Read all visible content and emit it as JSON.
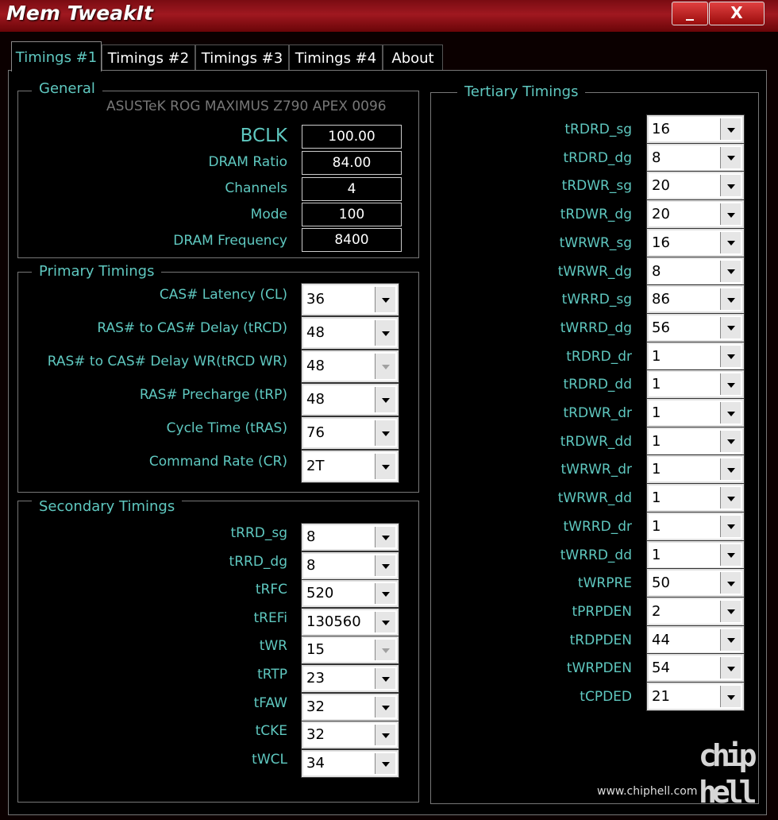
{
  "window": {
    "title": "Mem TweakIt",
    "minimize": "_",
    "close": "X"
  },
  "tabs": [
    "Timings #1",
    "Timings #2",
    "Timings #3",
    "Timings #4",
    "About"
  ],
  "general": {
    "legend": "General",
    "board": "ASUSTeK ROG MAXIMUS Z790 APEX 0096",
    "fields": [
      {
        "label": "BCLK",
        "value": "100.00"
      },
      {
        "label": "DRAM Ratio",
        "value": "84.00"
      },
      {
        "label": "Channels",
        "value": "4"
      },
      {
        "label": "Mode",
        "value": "100"
      },
      {
        "label": "DRAM Frequency",
        "value": "8400"
      }
    ]
  },
  "primary": {
    "legend": "Primary Timings",
    "rows": [
      {
        "label": "CAS# Latency (CL)",
        "value": "36"
      },
      {
        "label": "RAS# to CAS# Delay (tRCD)",
        "value": "48"
      },
      {
        "label": "RAS# to CAS# Delay WR(tRCD WR)",
        "value": "48",
        "disabled": true
      },
      {
        "label": "RAS# Precharge (tRP)",
        "value": "48"
      },
      {
        "label": "Cycle Time (tRAS)",
        "value": "76"
      },
      {
        "label": "Command Rate (CR)",
        "value": "2T"
      }
    ]
  },
  "secondary": {
    "legend": "Secondary Timings",
    "rows": [
      {
        "label": "tRRD_sg",
        "value": "8"
      },
      {
        "label": "tRRD_dg",
        "value": "8"
      },
      {
        "label": "tRFC",
        "value": "520"
      },
      {
        "label": "tREFi",
        "value": "130560"
      },
      {
        "label": "tWR",
        "value": "15",
        "disabled": true
      },
      {
        "label": "tRTP",
        "value": "23"
      },
      {
        "label": "tFAW",
        "value": "32"
      },
      {
        "label": "tCKE",
        "value": "32"
      },
      {
        "label": "tWCL",
        "value": "34"
      }
    ]
  },
  "tertiary": {
    "legend": "Tertiary Timings",
    "rows": [
      {
        "label": "tRDRD_sg",
        "value": "16"
      },
      {
        "label": "tRDRD_dg",
        "value": "8"
      },
      {
        "label": "tRDWR_sg",
        "value": "20"
      },
      {
        "label": "tRDWR_dg",
        "value": "20"
      },
      {
        "label": "tWRWR_sg",
        "value": "16"
      },
      {
        "label": "tWRWR_dg",
        "value": "8"
      },
      {
        "label": "tWRRD_sg",
        "value": "86"
      },
      {
        "label": "tWRRD_dg",
        "value": "56"
      },
      {
        "label": "tRDRD_dr",
        "value": "1"
      },
      {
        "label": "tRDRD_dd",
        "value": "1"
      },
      {
        "label": "tRDWR_dr",
        "value": "1"
      },
      {
        "label": "tRDWR_dd",
        "value": "1"
      },
      {
        "label": "tWRWR_dr",
        "value": "1"
      },
      {
        "label": "tWRWR_dd",
        "value": "1"
      },
      {
        "label": "tWRRD_dr",
        "value": "1"
      },
      {
        "label": "tWRRD_dd",
        "value": "1"
      },
      {
        "label": "tWRPRE",
        "value": "50"
      },
      {
        "label": "tPRPDEN",
        "value": "2"
      },
      {
        "label": "tRDPDEN",
        "value": "44"
      },
      {
        "label": "tWRPDEN",
        "value": "54"
      },
      {
        "label": "tCPDED",
        "value": "21"
      }
    ]
  },
  "watermark": {
    "site": "www.chiphell.com",
    "logo_top": "chip",
    "logo_bottom": "hell"
  }
}
